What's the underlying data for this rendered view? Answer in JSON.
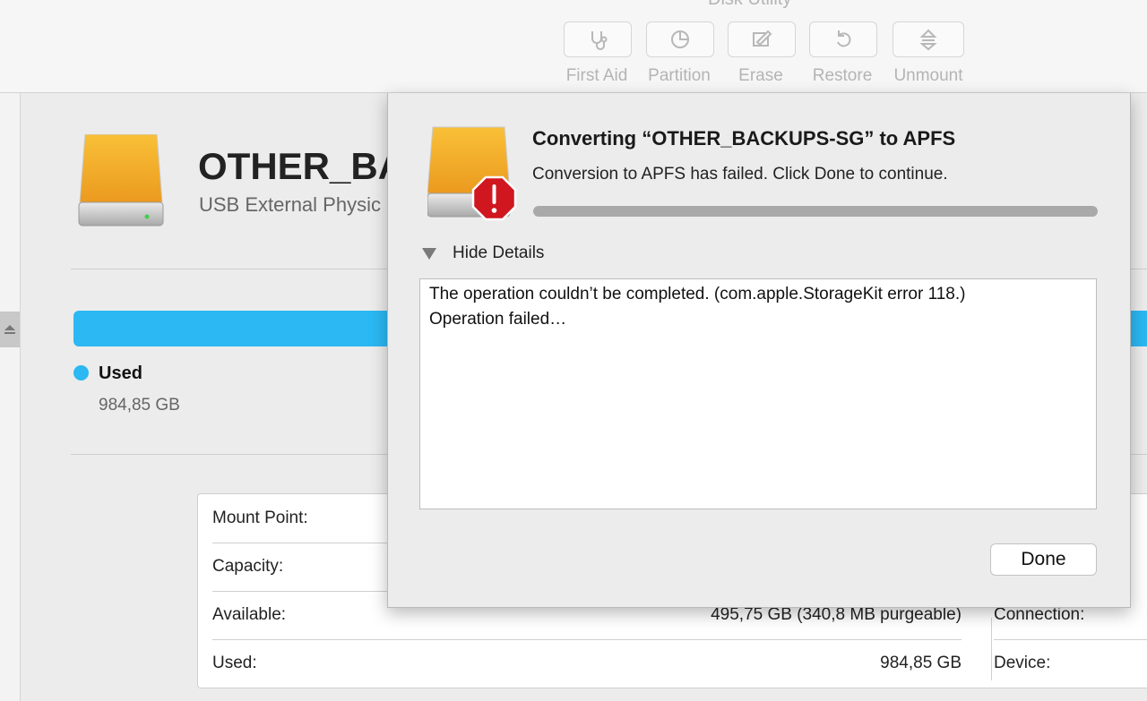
{
  "window": {
    "title": "Disk Utility"
  },
  "toolbar": {
    "buttons": [
      {
        "label": "First Aid",
        "icon": "stethoscope-icon"
      },
      {
        "label": "Partition",
        "icon": "pie-chart-icon"
      },
      {
        "label": "Erase",
        "icon": "erase-icon"
      },
      {
        "label": "Restore",
        "icon": "restore-icon"
      },
      {
        "label": "Unmount",
        "icon": "unmount-icon"
      }
    ]
  },
  "disk": {
    "name": "OTHER_BA",
    "subtitle": "USB External Physic",
    "usage": {
      "label": "Used",
      "value": "984,85 GB",
      "color": "#2bb8f3"
    }
  },
  "info": {
    "left": [
      {
        "key": "Mount Point:",
        "value": ""
      },
      {
        "key": "Capacity:",
        "value": ""
      },
      {
        "key": "Available:",
        "value": "495,75 GB (340,8 MB purgeable)"
      },
      {
        "key": "Used:",
        "value": "984,85 GB"
      }
    ],
    "right": [
      {
        "key": "Connection:"
      },
      {
        "key": "Device:"
      }
    ]
  },
  "dialog": {
    "title": "Converting “OTHER_BACKUPS-SG” to APFS",
    "message": "Conversion to APFS has failed. Click Done to continue.",
    "progress": 1.0,
    "details_toggle": "Hide Details",
    "details_lines": [
      "The operation couldn’t be completed. (com.apple.StorageKit error 118.)",
      "Operation failed…"
    ],
    "done_label": "Done",
    "alert_color": "#d0161f"
  }
}
